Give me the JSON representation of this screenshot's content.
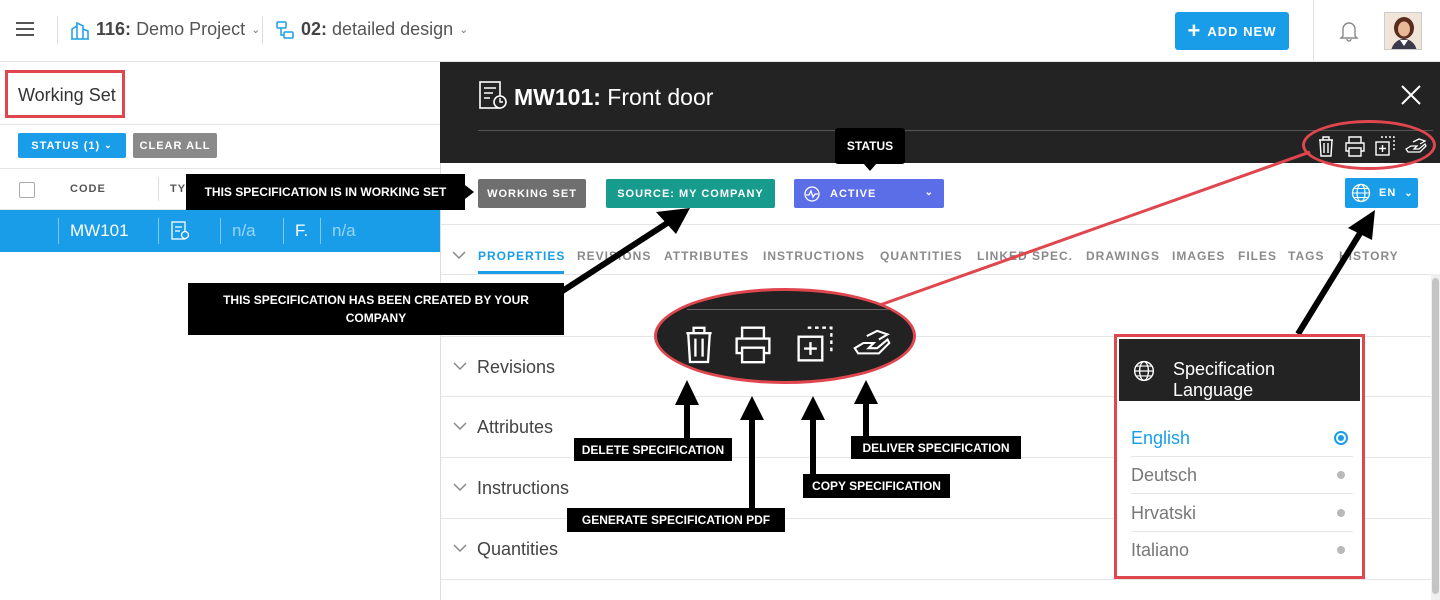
{
  "topbar": {
    "project_code": "116:",
    "project_name": "Demo Project",
    "phase_code": "02:",
    "phase_name": "detailed design",
    "add_new_label": "ADD NEW"
  },
  "left_panel": {
    "title": "Working Set",
    "status_filter_label": "STATUS (1)",
    "clear_all_label": "CLEAR ALL",
    "columns": [
      "CODE",
      "TY"
    ],
    "row": {
      "code": "MW101",
      "col3": "n/a",
      "col4": "F.",
      "col5": "n/a"
    }
  },
  "spec": {
    "code": "MW101:",
    "name": "Front door",
    "badges": {
      "working_set": "WORKING SET",
      "source": "SOURCE: MY COMPANY",
      "status": "ACTIVE",
      "language": "EN"
    },
    "tabs": [
      "PROPERTIES",
      "REVISIONS",
      "ATTRIBUTES",
      "INSTRUCTIONS",
      "QUANTITIES",
      "LINKED SPEC.",
      "DRAWINGS",
      "IMAGES",
      "FILES",
      "TAGS",
      "HISTORY"
    ],
    "active_tab": "PROPERTIES",
    "sections": [
      "Revisions",
      "Attributes",
      "Instructions",
      "Quantities"
    ]
  },
  "annotations": {
    "status": "STATUS",
    "working_set": "THIS SPECIFICATION IS IN WORKING SET",
    "created_by_line1": "THIS SPECIFICATION HAS BEEN CREATED BY YOUR",
    "created_by_line2": "COMPANY",
    "delete": "DELETE SPECIFICATION",
    "generate_pdf": "GENERATE SPECIFICATION PDF",
    "copy": "COPY SPECIFICATION",
    "deliver": "DELIVER SPECIFICATION"
  },
  "language_menu": {
    "title": "Specification Language",
    "options": [
      "English",
      "Deutsch",
      "Hrvatski",
      "Italiano"
    ],
    "selected": "English"
  },
  "colors": {
    "accent": "#1a9de8",
    "highlight": "#e0464e",
    "source_badge": "#179b8d",
    "status_badge": "#5b6ee8",
    "header_dark": "#232323"
  }
}
